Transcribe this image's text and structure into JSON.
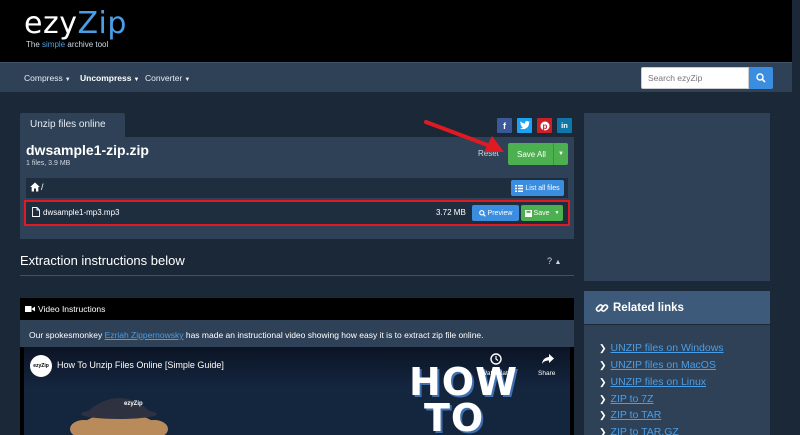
{
  "header": {
    "logo_main_a": "ezy",
    "logo_main_b": "Zip",
    "tagline_a": "The ",
    "tagline_b": "simple",
    "tagline_c": " archive tool"
  },
  "nav": {
    "items": [
      {
        "label": "Compress"
      },
      {
        "label": "Uncompress"
      },
      {
        "label": "Converter"
      }
    ],
    "search_placeholder": "Search ezyZip"
  },
  "panel": {
    "tab": "Unzip files online",
    "archive_name": "dwsample1-zip.zip",
    "archive_meta": "1 files, 3.9 MB",
    "reset": "Reset",
    "save_all": "Save All",
    "path": "/",
    "list_all": "List all files",
    "file": {
      "name": "dwsample1-mp3.mp3",
      "size": "3.72 MB",
      "preview": "Preview",
      "save": "Save"
    }
  },
  "social": [
    {
      "icon": "facebook-icon",
      "glyph": "f",
      "color": "#3b5998"
    },
    {
      "icon": "twitter-icon",
      "glyph": "t",
      "color": "#1da1f2"
    },
    {
      "icon": "pinterest-icon",
      "glyph": "p",
      "color": "#cb2027"
    },
    {
      "icon": "linkedin-icon",
      "glyph": "in",
      "color": "#0e76a8"
    }
  ],
  "extraction": {
    "title": "Extraction instructions below",
    "help": "?"
  },
  "video": {
    "header": "Video Instructions",
    "desc_a": "Our spokesmonkey ",
    "desc_link": "Ezriah Zippernowsky",
    "desc_b": " has made an instructional video showing how easy it is to extract zip file online.",
    "yt_title": "How To Unzip Files Online [Simple Guide]",
    "watch_later": "Watch later",
    "share": "Share",
    "thumb_line1": "HOW",
    "thumb_line2": "TO",
    "channel": "ezyZip",
    "cap_text": "ezyZip"
  },
  "related": {
    "title": "Related links",
    "links": [
      "UNZIP files on Windows",
      "UNZIP files on MacOS",
      "UNZIP files on Linux",
      "ZIP to 7Z",
      "ZIP to TAR",
      "ZIP to TAR.GZ"
    ]
  },
  "colors": {
    "accent": "#3b8de0",
    "save_green": "#4caf50",
    "highlight_red": "#e01a22",
    "page_bg": "#1b2838",
    "panel_bg": "#2e4156"
  }
}
